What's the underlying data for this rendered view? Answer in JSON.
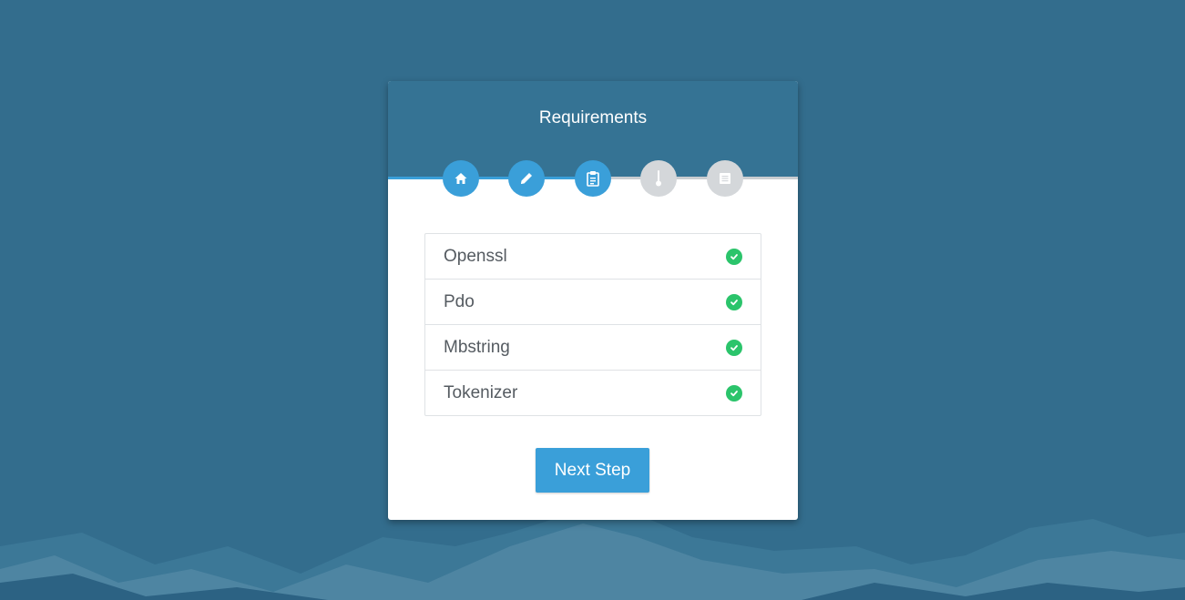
{
  "page": {
    "title": "Requirements"
  },
  "steps": [
    {
      "icon": "home-icon",
      "state": "done"
    },
    {
      "icon": "pencil-icon",
      "state": "done"
    },
    {
      "icon": "clipboard-icon",
      "state": "current"
    },
    {
      "icon": "thermometer-icon",
      "state": "pending"
    },
    {
      "icon": "list-icon",
      "state": "pending"
    }
  ],
  "progress_fraction": 0.5,
  "requirements": [
    {
      "label": "Openssl",
      "status": "ok"
    },
    {
      "label": "Pdo",
      "status": "ok"
    },
    {
      "label": "Mbstring",
      "status": "ok"
    },
    {
      "label": "Tokenizer",
      "status": "ok"
    }
  ],
  "actions": {
    "next_label": "Next Step"
  },
  "colors": {
    "background": "#336d8d",
    "header": "#357394",
    "accent": "#3a9fd9",
    "inactive_step": "#d4d7da",
    "success": "#2bc46b"
  }
}
